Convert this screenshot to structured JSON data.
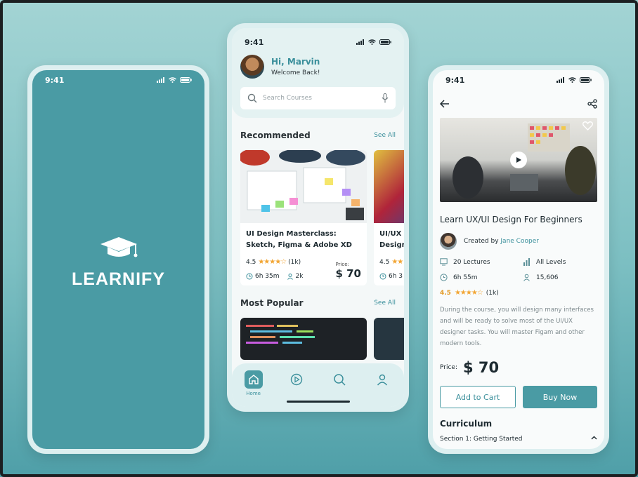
{
  "status_time": "9:41",
  "splash": {
    "brand": "LEARNIFY"
  },
  "home": {
    "greeting": "Hi, Marvin",
    "welcome": "Welcome Back!",
    "search_placeholder": "Search Courses",
    "recommended_title": "Recommended",
    "see_all": "See All",
    "courses": [
      {
        "title": "UI Design Masterclass: Sketch, Figma & Adobe XD",
        "rating": "4.5",
        "reviews": "(1k)",
        "duration": "6h 35m",
        "students": "2k",
        "price_label": "Price:",
        "price": "$ 70"
      },
      {
        "title": "UI/UX I Design",
        "rating": "4.5",
        "duration": "6h 3"
      }
    ],
    "popular_title": "Most Popular",
    "tabs": [
      {
        "label": "Home",
        "icon": "home-icon"
      },
      {
        "label": "",
        "icon": "play-icon"
      },
      {
        "label": "",
        "icon": "search-icon"
      },
      {
        "label": "",
        "icon": "profile-icon"
      }
    ]
  },
  "detail": {
    "title": "Learn UX/UI Design For Beginners",
    "created_by": "Created by",
    "creator": "Jane Cooper",
    "lectures": "20 Lectures",
    "levels": "All Levels",
    "duration": "6h 55m",
    "students": "15,606",
    "rating": "4.5",
    "reviews": "(1k)",
    "description": "During the course, you will design many interfaces and will be ready to solve most of the UI/UX designer tasks. You will master Figam and other modern tools.",
    "price_label": "Price:",
    "price": "$ 70",
    "add_to_cart": "Add to Cart",
    "buy_now": "Buy Now",
    "curriculum_title": "Curriculum",
    "section_1": "Section 1: Getting Started"
  },
  "colors": {
    "accent": "#4a9ba4",
    "star": "#f2a533",
    "background": "#7cbfc2"
  }
}
